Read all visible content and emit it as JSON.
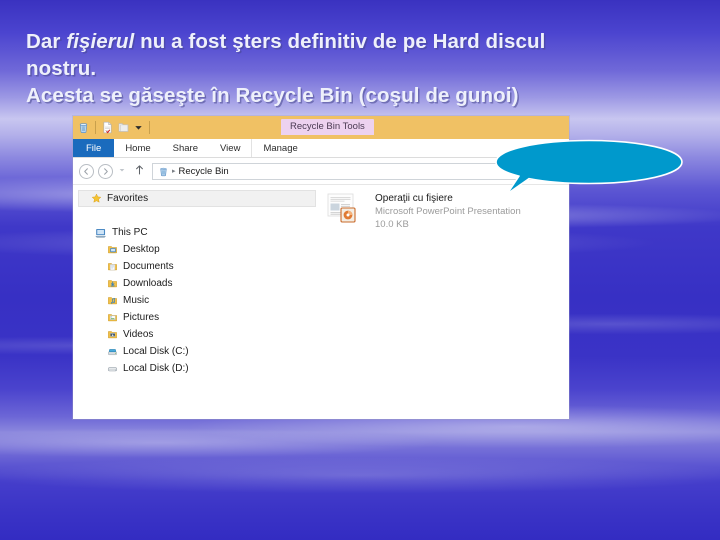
{
  "slide": {
    "heading": {
      "line1_a": "Dar ",
      "line1_italic": "fişierul",
      "line1_b": " nu a fost şters definitiv de pe  Hard discul",
      "line2": "nostru.",
      "line3": "Acesta se găseşte în Recycle Bin (coşul de gunoi)"
    },
    "background_color": "#3a33c6",
    "heading_color": "#eef0fb"
  },
  "callout": {
    "name": "speech-bubble",
    "text": "",
    "fill_color": "#0099cc",
    "outline_color": "#ffffff"
  },
  "explorer": {
    "titlebar": {
      "color": "#f0c164",
      "quick_access": [
        {
          "name": "recycle-bin-icon",
          "label": "Recycle Bin"
        },
        {
          "name": "properties-icon",
          "label": "Properties"
        },
        {
          "name": "folder-icon",
          "label": "New folder"
        },
        {
          "name": "chevron-down-icon",
          "label": "Customize Quick Access Toolbar"
        }
      ],
      "contextual_tab": "Recycle Bin Tools",
      "contextual_tab_color": "#edd2ef"
    },
    "ribbon": {
      "active_tab": "File",
      "file_tab_color": "#1a6bbd",
      "tabs": [
        {
          "label": "File",
          "active": true
        },
        {
          "label": "Home",
          "active": false
        },
        {
          "label": "Share",
          "active": false
        },
        {
          "label": "View",
          "active": false
        },
        {
          "label": "Manage",
          "active": false
        }
      ]
    },
    "addressbar": {
      "back_icon": "back-arrow-icon",
      "forward_icon": "forward-arrow-icon",
      "recent_icon": "chevron-down-icon",
      "up_icon": "up-arrow-icon",
      "location_icon": "recycle-bin-icon",
      "location": "Recycle Bin",
      "separator": "▸"
    },
    "nav_pane": {
      "favorites": {
        "label": "Favorites",
        "icon": "star-icon",
        "selected": true
      },
      "tree": [
        {
          "label": "This PC",
          "icon": "computer-icon",
          "level": 0
        },
        {
          "label": "Desktop",
          "icon": "desktop-icon",
          "level": 1
        },
        {
          "label": "Documents",
          "icon": "documents-icon",
          "level": 1
        },
        {
          "label": "Downloads",
          "icon": "downloads-icon",
          "level": 1
        },
        {
          "label": "Music",
          "icon": "music-icon",
          "level": 1
        },
        {
          "label": "Pictures",
          "icon": "pictures-icon",
          "level": 1
        },
        {
          "label": "Videos",
          "icon": "videos-icon",
          "level": 1
        },
        {
          "label": "Local Disk (C:)",
          "icon": "harddisk-icon",
          "level": 1
        },
        {
          "label": "Local Disk (D:)",
          "icon": "disk-icon",
          "level": 1
        }
      ]
    },
    "content_pane": {
      "items": [
        {
          "name": "Operaţii cu fişiere",
          "type": "Microsoft PowerPoint Presentation",
          "size": "10.0 KB",
          "icon": "powerpoint-file-icon"
        }
      ]
    }
  }
}
